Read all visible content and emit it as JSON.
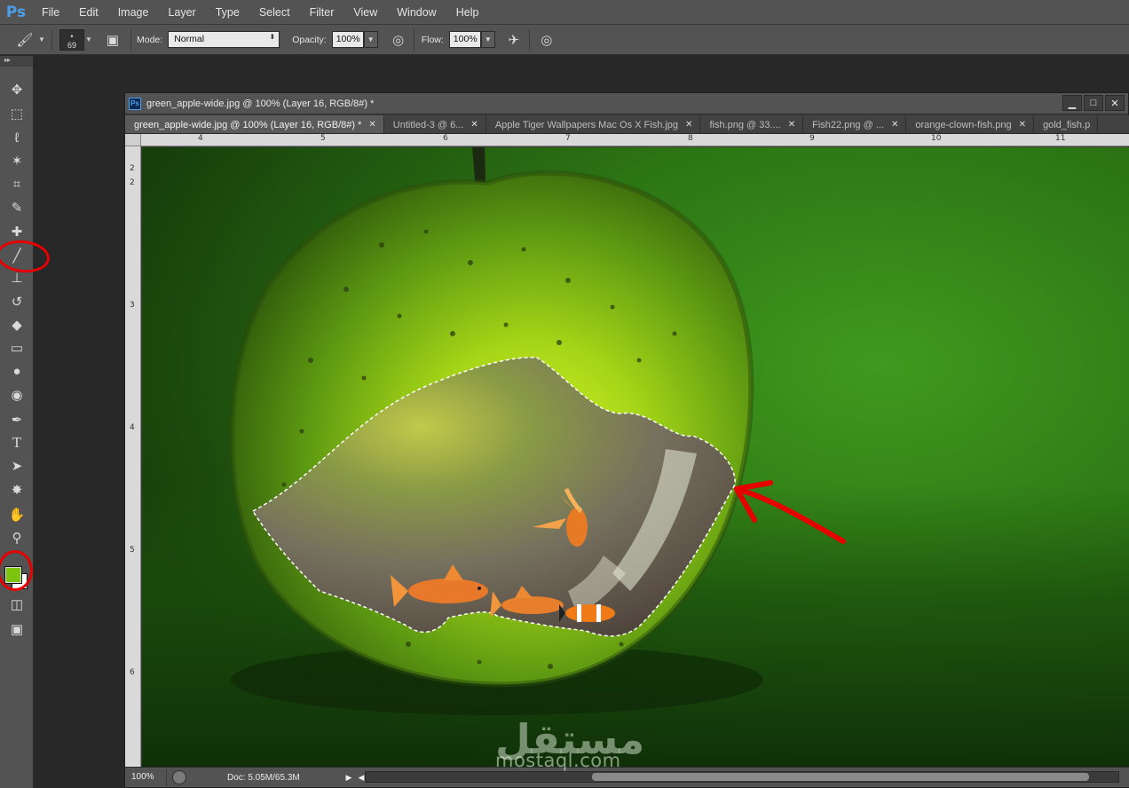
{
  "app": {
    "logo": "Ps"
  },
  "menu": [
    "File",
    "Edit",
    "Image",
    "Layer",
    "Type",
    "Select",
    "Filter",
    "View",
    "Window",
    "Help"
  ],
  "options": {
    "brush_size": "69",
    "mode_label": "Mode:",
    "mode_value": "Normal",
    "opacity_label": "Opacity:",
    "opacity_value": "100%",
    "flow_label": "Flow:",
    "flow_value": "100%"
  },
  "toolbox": {
    "tools": [
      {
        "name": "move-tool-icon",
        "glyph": "✥"
      },
      {
        "name": "marquee-tool-icon",
        "glyph": "⬚"
      },
      {
        "name": "lasso-tool-icon",
        "glyph": "➰"
      },
      {
        "name": "magic-wand-tool-icon",
        "glyph": "✶"
      },
      {
        "name": "crop-tool-icon",
        "glyph": "⌗"
      },
      {
        "name": "eyedropper-tool-icon",
        "glyph": "✎"
      },
      {
        "name": "healing-brush-tool-icon",
        "glyph": "✚"
      },
      {
        "name": "brush-tool-icon",
        "glyph": "🖌"
      },
      {
        "name": "clone-stamp-tool-icon",
        "glyph": "⊥"
      },
      {
        "name": "history-brush-tool-icon",
        "glyph": "↺"
      },
      {
        "name": "eraser-tool-icon",
        "glyph": "◆"
      },
      {
        "name": "gradient-tool-icon",
        "glyph": "▭"
      },
      {
        "name": "blur-tool-icon",
        "glyph": "●"
      },
      {
        "name": "dodge-tool-icon",
        "glyph": "◉"
      },
      {
        "name": "pen-tool-icon",
        "glyph": "✒"
      },
      {
        "name": "type-tool-icon",
        "glyph": "T"
      },
      {
        "name": "path-selection-tool-icon",
        "glyph": "➤"
      },
      {
        "name": "shape-tool-icon",
        "glyph": "✸"
      },
      {
        "name": "hand-tool-icon",
        "glyph": "✋"
      },
      {
        "name": "zoom-tool-icon",
        "glyph": "⚲"
      }
    ],
    "foreground_color": "#7cc40e",
    "background_color": "#ffffff"
  },
  "document": {
    "title": "green_apple-wide.jpg @ 100% (Layer 16, RGB/8#) *",
    "tabs": [
      {
        "label": "green_apple-wide.jpg @ 100% (Layer 16, RGB/8#) *",
        "active": true
      },
      {
        "label": "Untitled-3 @ 6...",
        "active": false
      },
      {
        "label": "Apple Tiger Wallpapers Mac Os X Fish.jpg",
        "active": false
      },
      {
        "label": "fish.png @ 33....",
        "active": false
      },
      {
        "label": "Fish22.png @ ...",
        "active": false
      },
      {
        "label": "orange-clown-fish.png",
        "active": false
      },
      {
        "label": "gold_fish.p",
        "active": false
      }
    ],
    "ruler_h": [
      "4",
      "5",
      "6",
      "7",
      "8",
      "9",
      "10",
      "11"
    ],
    "ruler_v": [
      "2",
      "2",
      "3",
      "4",
      "5",
      "6"
    ]
  },
  "status": {
    "zoom": "100%",
    "doc_info": "Doc: 5.05M/65.3M"
  },
  "watermark": {
    "arabic": "مستقل",
    "latin": "mostaql.com"
  },
  "annotation_color": "#e60000"
}
